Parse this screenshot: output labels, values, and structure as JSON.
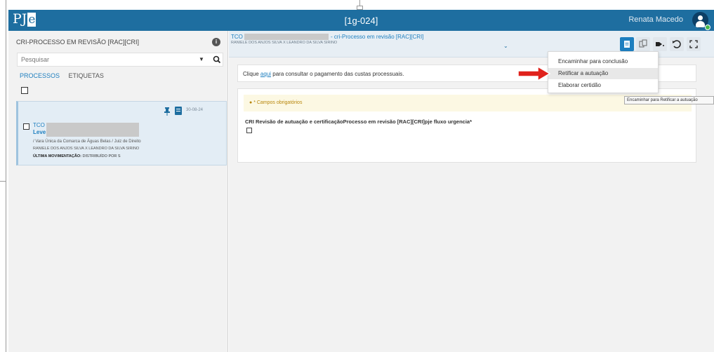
{
  "header": {
    "logo_prefix": "PJ",
    "logo_suffix": "e",
    "center_title": "[1g-024]",
    "user_name": "Renata Macedo"
  },
  "sidebar": {
    "title": "CRI-PROCESSO EM REVISÃO [RAC][CRI]",
    "info_badge": "i",
    "search_placeholder": "Pesquisar",
    "tabs": [
      {
        "label": "PROCESSOS",
        "active": true
      },
      {
        "label": "ETIQUETAS",
        "active": false
      }
    ],
    "card": {
      "date": "30-08-24",
      "code": "TCO",
      "priority": "Leve",
      "court": "/ Vara Única da Comarca de Águas Belas / Juiz de Direito",
      "parties": "RANIELE DOS ANJOS SILVA X LEANDRO DA SILVA SIRINO",
      "last_move_label": "ÚLTIMA MOVIMENTAÇÃO:",
      "last_move_value": "DISTRIBUÍDO POR S"
    }
  },
  "process": {
    "code": "TCO",
    "title": "- cri-Processo em revisão [RAC][CRI]",
    "parties": "RANIELE DOS ANJOS SILVA X LEANDRO DA SILVA SIRINO",
    "notice_before": "Clique ",
    "notice_link": "aqui",
    "notice_after": " para consultar o pagamento das custas processuais.",
    "required_note": "* Campos obrigatórios",
    "field_label": "CRI Revisão de autuação e certificaçãoProcesso em revisão [RAC][CRI]pje fluxo urgencia*"
  },
  "menu": {
    "items": [
      {
        "label": "Encaminhar para conclusão"
      },
      {
        "label": "Retificar a autuação",
        "highlighted": true
      },
      {
        "label": "Elaborar certidão"
      }
    ],
    "tooltip": "Encaminhar para Retificar a autuação"
  },
  "colors": {
    "header_blue": "#1e6ea0",
    "link_blue": "#1e7fbf",
    "arrow_red": "#e0221c",
    "card_bg": "#e3edf5"
  }
}
